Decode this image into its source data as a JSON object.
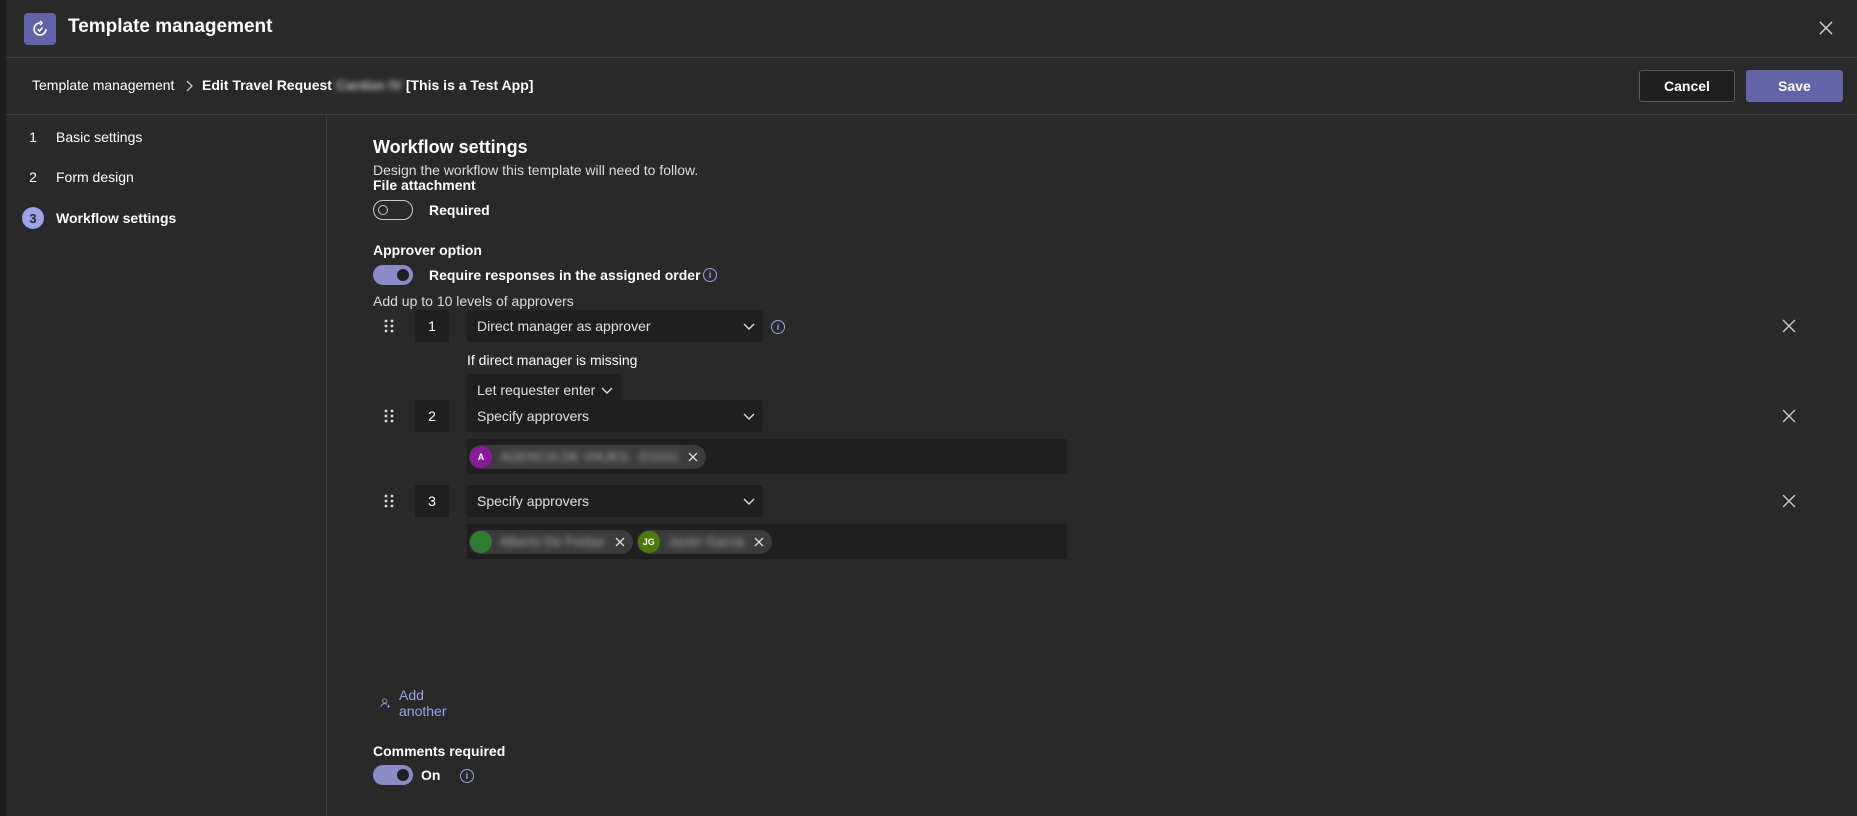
{
  "header": {
    "title": "Template management"
  },
  "breadcrumb": {
    "parent": "Template management",
    "current_prefix": "Edit Travel Request",
    "current_blurred": "Cardon IV",
    "current_suffix": "[This is a Test App]"
  },
  "actions": {
    "cancel": "Cancel",
    "save": "Save"
  },
  "steps": [
    {
      "num": "1",
      "label": "Basic settings"
    },
    {
      "num": "2",
      "label": "Form design"
    },
    {
      "num": "3",
      "label": "Workflow settings"
    }
  ],
  "workflow": {
    "title": "Workflow settings",
    "subtitle": "Design the workflow this template will need to follow.",
    "file_attachment": {
      "label": "File attachment",
      "toggle_label": "Required",
      "on": false
    },
    "approver_option": {
      "label": "Approver option",
      "toggle_label": "Require responses in the assigned order",
      "on": true,
      "helper": "Add up to 10 levels of approvers"
    },
    "levels": [
      {
        "num": "1",
        "type": "Direct manager as approver",
        "missing_label": "If direct manager is missing",
        "missing_value": "Let requester enter"
      },
      {
        "num": "2",
        "type": "Specify approvers",
        "approvers": [
          {
            "initials": "A",
            "name": "AGENCIA DE VIAJES - EGGG",
            "color": "#8a1a9b"
          }
        ]
      },
      {
        "num": "3",
        "type": "Specify approvers",
        "approvers": [
          {
            "initials": "",
            "name": "Alberto De Freitas",
            "color": "#2e7d32"
          },
          {
            "initials": "JG",
            "name": "Javier Garcia",
            "color": "#4b7c0a"
          }
        ]
      }
    ],
    "add_another": "Add another",
    "comments": {
      "label": "Comments required",
      "toggle_label": "On",
      "on": true
    }
  },
  "icons": {
    "app": "approvals-icon",
    "close": "close-icon",
    "info": "info-icon",
    "drag": "drag-handle-icon",
    "add": "add-person-icon"
  },
  "colors": {
    "accent": "#6264a7",
    "accent_light": "#9ea2e6",
    "background": "#292929",
    "field": "#1f1f1f"
  }
}
